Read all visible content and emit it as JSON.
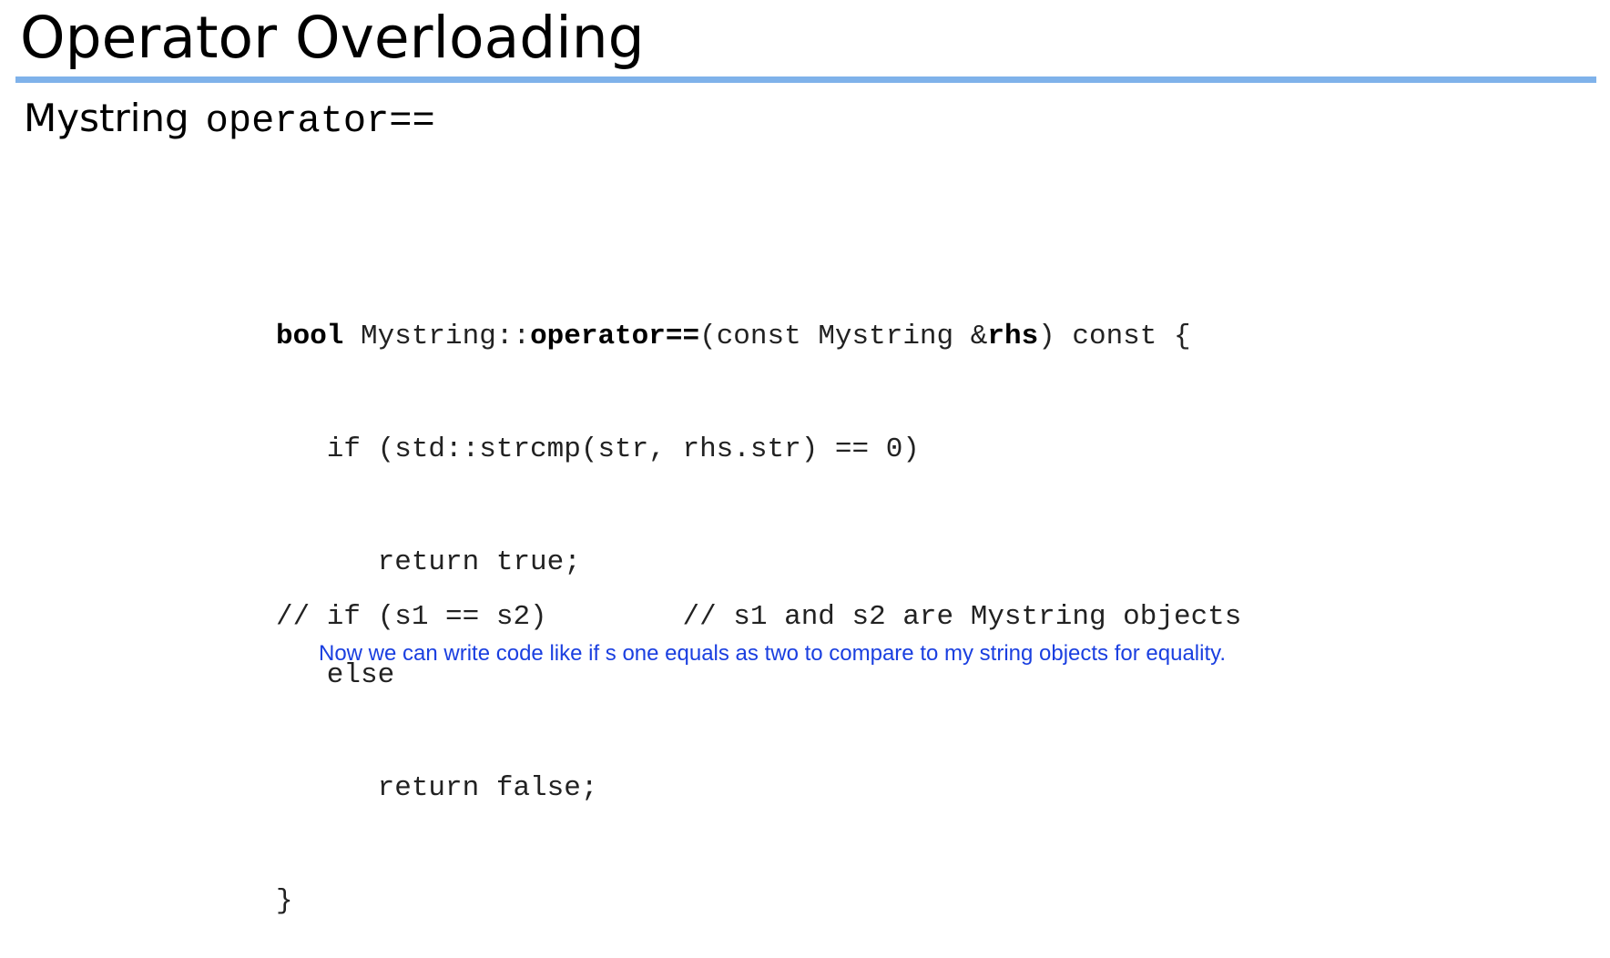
{
  "slide": {
    "title": "Operator Overloading",
    "subtitle_word": "Mystring",
    "subtitle_code": "operator=="
  },
  "code": {
    "line1": {
      "kw_bool": "bool",
      "class_scope": " Mystring::",
      "kw_operator": "operator==",
      "params_open": "(const Mystring &",
      "param_rhs": "rhs",
      "params_close": ") const {"
    },
    "line2": "   if (std::strcmp(str, rhs.str) == 0)",
    "line3": "      return true;",
    "line4": "   else",
    "line5": "      return false;",
    "line6": "}"
  },
  "usage_comment": "// if (s1 == s2)        // s1 and s2 are Mystring objects",
  "caption": "Now we can write code like if s one equals as two to compare to my string objects for equality."
}
